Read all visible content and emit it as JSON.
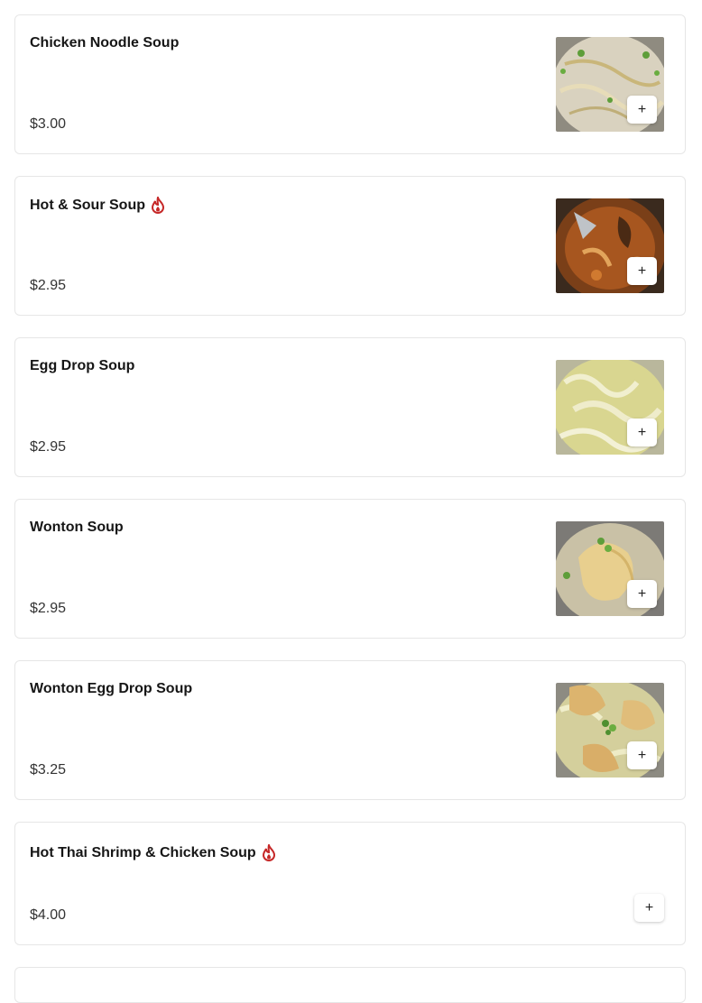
{
  "colors": {
    "spicy": "#c62828",
    "border": "#e6e6e6",
    "text": "#161616",
    "price": "#333333"
  },
  "items": [
    {
      "name": "Chicken Noodle Soup",
      "price": "$3.00",
      "spicy": false,
      "image": "chicken-noodle-soup-photo",
      "add_label": "+",
      "add_icon": "plus-icon"
    },
    {
      "name": "Hot & Sour Soup",
      "price": "$2.95",
      "spicy": true,
      "spicy_icon": "flame-icon",
      "image": "hot-sour-soup-photo",
      "add_label": "+",
      "add_icon": "plus-icon"
    },
    {
      "name": "Egg Drop Soup",
      "price": "$2.95",
      "spicy": false,
      "image": "egg-drop-soup-photo",
      "add_label": "+",
      "add_icon": "plus-icon"
    },
    {
      "name": "Wonton Soup",
      "price": "$2.95",
      "spicy": false,
      "image": "wonton-soup-photo",
      "add_label": "+",
      "add_icon": "plus-icon"
    },
    {
      "name": "Wonton Egg Drop Soup",
      "price": "$3.25",
      "spicy": false,
      "image": "wonton-egg-drop-soup-photo",
      "add_label": "+",
      "add_icon": "plus-icon"
    },
    {
      "name": "Hot Thai Shrimp & Chicken Soup",
      "price": "$4.00",
      "spicy": true,
      "spicy_icon": "flame-icon",
      "image": null,
      "add_label": "+",
      "add_icon": "plus-icon"
    }
  ]
}
